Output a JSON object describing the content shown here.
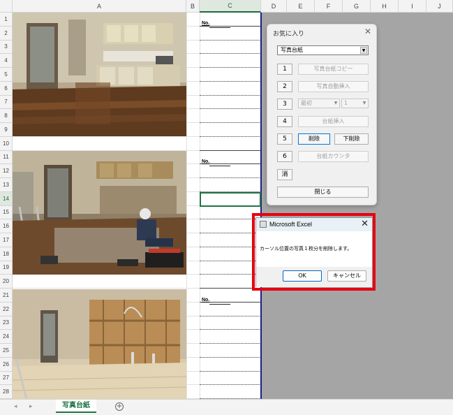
{
  "columns": [
    "A",
    "B",
    "C",
    "D",
    "E",
    "F",
    "G",
    "H",
    "I",
    "J"
  ],
  "rows": [
    "1",
    "2",
    "3",
    "4",
    "5",
    "6",
    "7",
    "8",
    "9",
    "10",
    "11",
    "12",
    "13",
    "14",
    "15",
    "16",
    "17",
    "18",
    "19",
    "20",
    "21",
    "22",
    "23",
    "24",
    "25",
    "26",
    "27",
    "28"
  ],
  "sheet": {
    "no_label": "No.",
    "tab_name": "写真台紙",
    "add_sheet": "⊕"
  },
  "userform": {
    "title": "お気に入り",
    "close": "✕",
    "combo_value": "写真台紙",
    "combo_arrow": "▼",
    "buttons": [
      {
        "num": "1",
        "label": "写真台紙コピー",
        "enabled": false
      },
      {
        "num": "2",
        "label": "写真自動挿入",
        "enabled": false
      },
      {
        "num": "4",
        "label": "台紙挿入",
        "enabled": false
      },
      {
        "num": "5",
        "label": "削除",
        "label2": "下削除",
        "enabled": true
      },
      {
        "num": "6",
        "label": "台紙カウンタ",
        "enabled": false
      }
    ],
    "row3": {
      "num": "3",
      "select1": "最初",
      "select2": "1"
    },
    "clear_label": "消",
    "close_label": "閉じる"
  },
  "msgbox": {
    "title": "Microsoft Excel",
    "close": "✕",
    "message": "カーソル位置の写真１枚分を削除します。",
    "ok_label": "OK",
    "cancel_label": "キャンセル"
  },
  "colors": {
    "excel_green": "#217346",
    "highlight_red": "#e60012",
    "page_border_blue": "#1e1e8a"
  }
}
